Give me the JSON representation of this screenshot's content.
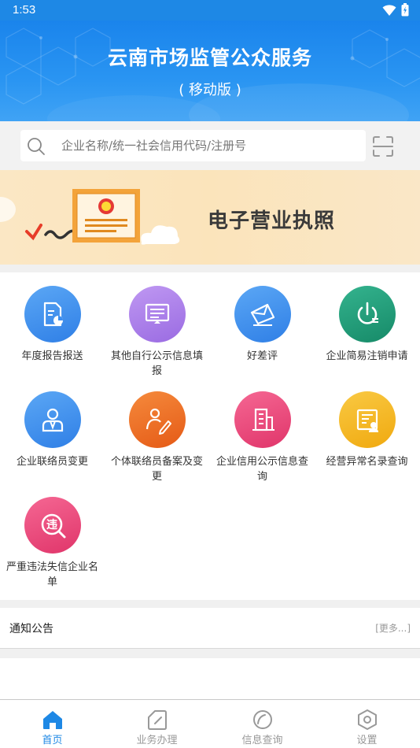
{
  "status": {
    "time": "1:53"
  },
  "header": {
    "title": "云南市场监管公众服务",
    "subtitle": "( 移动版 )"
  },
  "search": {
    "placeholder": "企业名称/统一社会信用代码/注册号"
  },
  "banner": {
    "text": "电子营业执照"
  },
  "services": [
    {
      "label": "年度报告报送",
      "icon": "report-icon",
      "color": "#3d8ff0"
    },
    {
      "label": "其他自行公示信息填报",
      "icon": "monitor-icon",
      "color": "#a77ce8"
    },
    {
      "label": "好差评",
      "icon": "envelope-icon",
      "color": "#3d8ff0"
    },
    {
      "label": "企业简易注销申请",
      "icon": "power-icon",
      "color": "#1e9e7a"
    },
    {
      "label": "企业联络员变更",
      "icon": "contact-person-icon",
      "color": "#3d8ff0"
    },
    {
      "label": "个体联络员备案及变更",
      "icon": "signature-icon",
      "color": "#ef6a23"
    },
    {
      "label": "企业信用公示信息查询",
      "icon": "building-icon",
      "color": "#ee4a7c"
    },
    {
      "label": "经营异常名录查询",
      "icon": "certificate-icon",
      "color": "#f6b820"
    },
    {
      "label": "严重违法失信企业名单",
      "icon": "violation-search-icon",
      "color": "#ee4a7c"
    }
  ],
  "notice": {
    "title": "通知公告",
    "more": "[更多...]"
  },
  "tabs": [
    {
      "label": "首页",
      "icon": "home-icon",
      "active": true
    },
    {
      "label": "业务办理",
      "icon": "document-icon",
      "active": false
    },
    {
      "label": "信息查询",
      "icon": "query-circle-icon",
      "active": false
    },
    {
      "label": "设置",
      "icon": "settings-hex-icon",
      "active": false
    }
  ]
}
